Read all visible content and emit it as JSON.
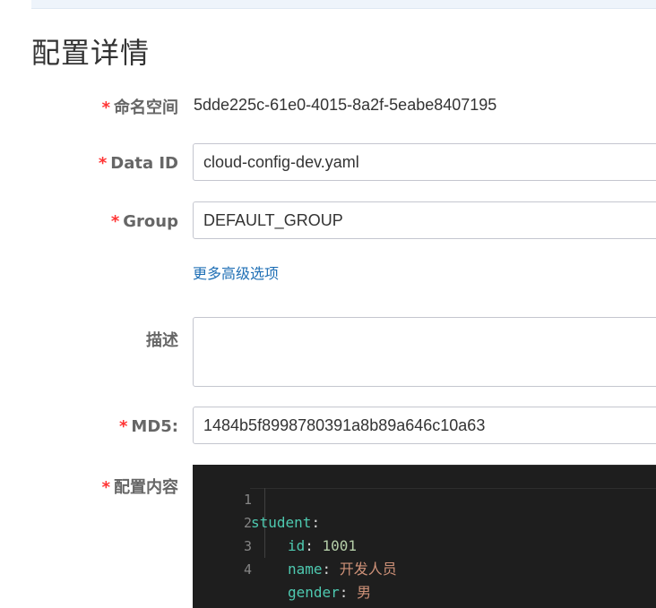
{
  "page": {
    "title": "配置详情"
  },
  "form": {
    "namespace": {
      "required_mark": "*",
      "label": "命名空间",
      "value": "5dde225c-61e0-4015-8a2f-5eabe8407195"
    },
    "data_id": {
      "required_mark": "*",
      "label": "Data ID",
      "value": "cloud-config-dev.yaml"
    },
    "group": {
      "required_mark": "*",
      "label": "Group",
      "value": "DEFAULT_GROUP"
    },
    "advanced_link": "更多高级选项",
    "description": {
      "label": "描述",
      "value": ""
    },
    "md5": {
      "required_mark": "*",
      "label": "MD5:",
      "value": "1484b5f8998780391a8b89a646c10a63"
    },
    "config_content": {
      "required_mark": "*",
      "label": "配置内容",
      "lines": [
        {
          "num": "1",
          "key": "student",
          "sep": ":",
          "val": ""
        },
        {
          "num": "2",
          "key": "id",
          "sep": ": ",
          "val": "1001"
        },
        {
          "num": "3",
          "key": "name",
          "sep": ": ",
          "val": "开发人员"
        },
        {
          "num": "4",
          "key": "gender",
          "sep": ": ",
          "val": "男"
        }
      ]
    }
  },
  "colors": {
    "required": "#ff3333",
    "link": "#1f6fb5",
    "editor_bg": "#1e1e1e"
  }
}
